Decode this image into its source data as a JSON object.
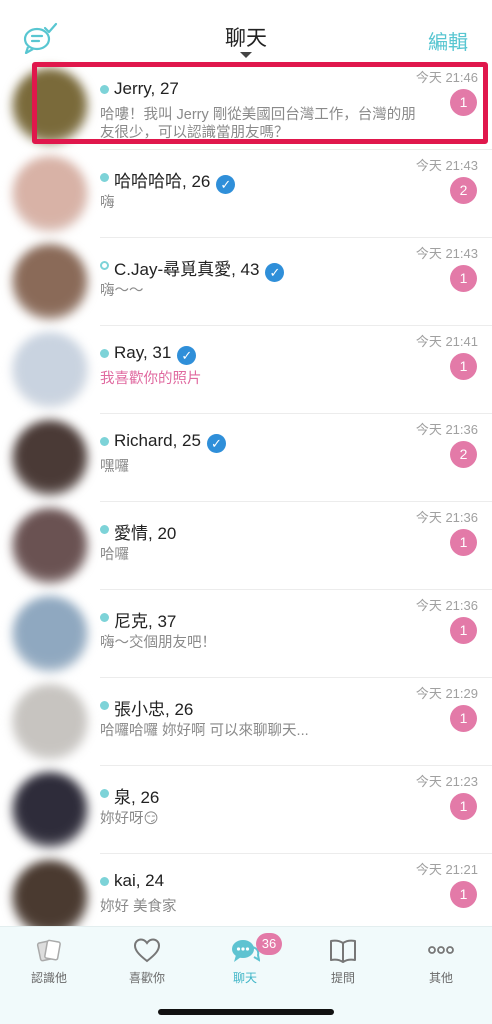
{
  "header": {
    "title": "聊天",
    "edit_label": "編輯",
    "left_icon": "chat-check-icon"
  },
  "chats": [
    {
      "name": "Jerry, 27",
      "verified": false,
      "message": "哈嘍！我叫 Jerry 剛從美國回台灣工作，台灣的朋友很少，可以認識當朋友嗎？",
      "time": "今天 21:46",
      "unread": "1",
      "avatar_color": "#7a6a3a",
      "dot": "solid",
      "msg_color": "gray"
    },
    {
      "name": "哈哈哈哈, 26",
      "verified": true,
      "message": "嗨",
      "time": "今天 21:43",
      "unread": "2",
      "avatar_color": "#d8b2a6",
      "dot": "solid",
      "msg_color": "gray"
    },
    {
      "name": "C.Jay-尋覓真愛, 43",
      "verified": true,
      "message": "嗨～～",
      "time": "今天 21:43",
      "unread": "1",
      "avatar_color": "#8a6a58",
      "dot": "hollow",
      "msg_color": "gray"
    },
    {
      "name": "Ray, 31",
      "verified": true,
      "message": "我喜歡你的照片",
      "time": "今天 21:41",
      "unread": "1",
      "avatar_color": "#c9d3e0",
      "dot": "solid",
      "msg_color": "pink"
    },
    {
      "name": "Richard, 25",
      "verified": true,
      "message": "嘿囉",
      "time": "今天 21:36",
      "unread": "2",
      "avatar_color": "#4a3a36",
      "dot": "solid",
      "msg_color": "gray"
    },
    {
      "name": "愛情, 20",
      "verified": false,
      "message": "哈囉",
      "time": "今天 21:36",
      "unread": "1",
      "avatar_color": "#6a5252",
      "dot": "solid",
      "msg_color": "gray"
    },
    {
      "name": "尼克, 37",
      "verified": false,
      "message": "嗨～交個朋友吧！",
      "time": "今天 21:36",
      "unread": "1",
      "avatar_color": "#8fa8c0",
      "dot": "solid",
      "msg_color": "gray"
    },
    {
      "name": "張小忠, 26",
      "verified": false,
      "message": "哈囉哈囉 妳好啊 可以來聊聊天...",
      "time": "今天 21:29",
      "unread": "1",
      "avatar_color": "#c7c4c0",
      "dot": "solid",
      "msg_color": "gray"
    },
    {
      "name": "泉, 26",
      "verified": false,
      "message": "妳好呀😏",
      "time": "今天 21:23",
      "unread": "1",
      "avatar_color": "#2e2c3a",
      "dot": "solid",
      "msg_color": "gray"
    },
    {
      "name": "kai, 24",
      "verified": false,
      "message": "妳好 美食家",
      "time": "今天 21:21",
      "unread": "1",
      "avatar_color": "#4a3a30",
      "dot": "solid",
      "msg_color": "gray"
    }
  ],
  "tabs": [
    {
      "label": "認識他",
      "icon": "cards-icon",
      "active": false
    },
    {
      "label": "喜歡你",
      "icon": "heart-icon",
      "active": false
    },
    {
      "label": "聊天",
      "icon": "chat-bubbles-icon",
      "active": true,
      "badge": "36"
    },
    {
      "label": "提問",
      "icon": "book-icon",
      "active": false
    },
    {
      "label": "其他",
      "icon": "more-dots-icon",
      "active": false
    }
  ],
  "colors": {
    "accent": "#58c6d1",
    "badge": "#e37aa8",
    "highlight": "#e0174c",
    "verified": "#2f8fd9"
  }
}
